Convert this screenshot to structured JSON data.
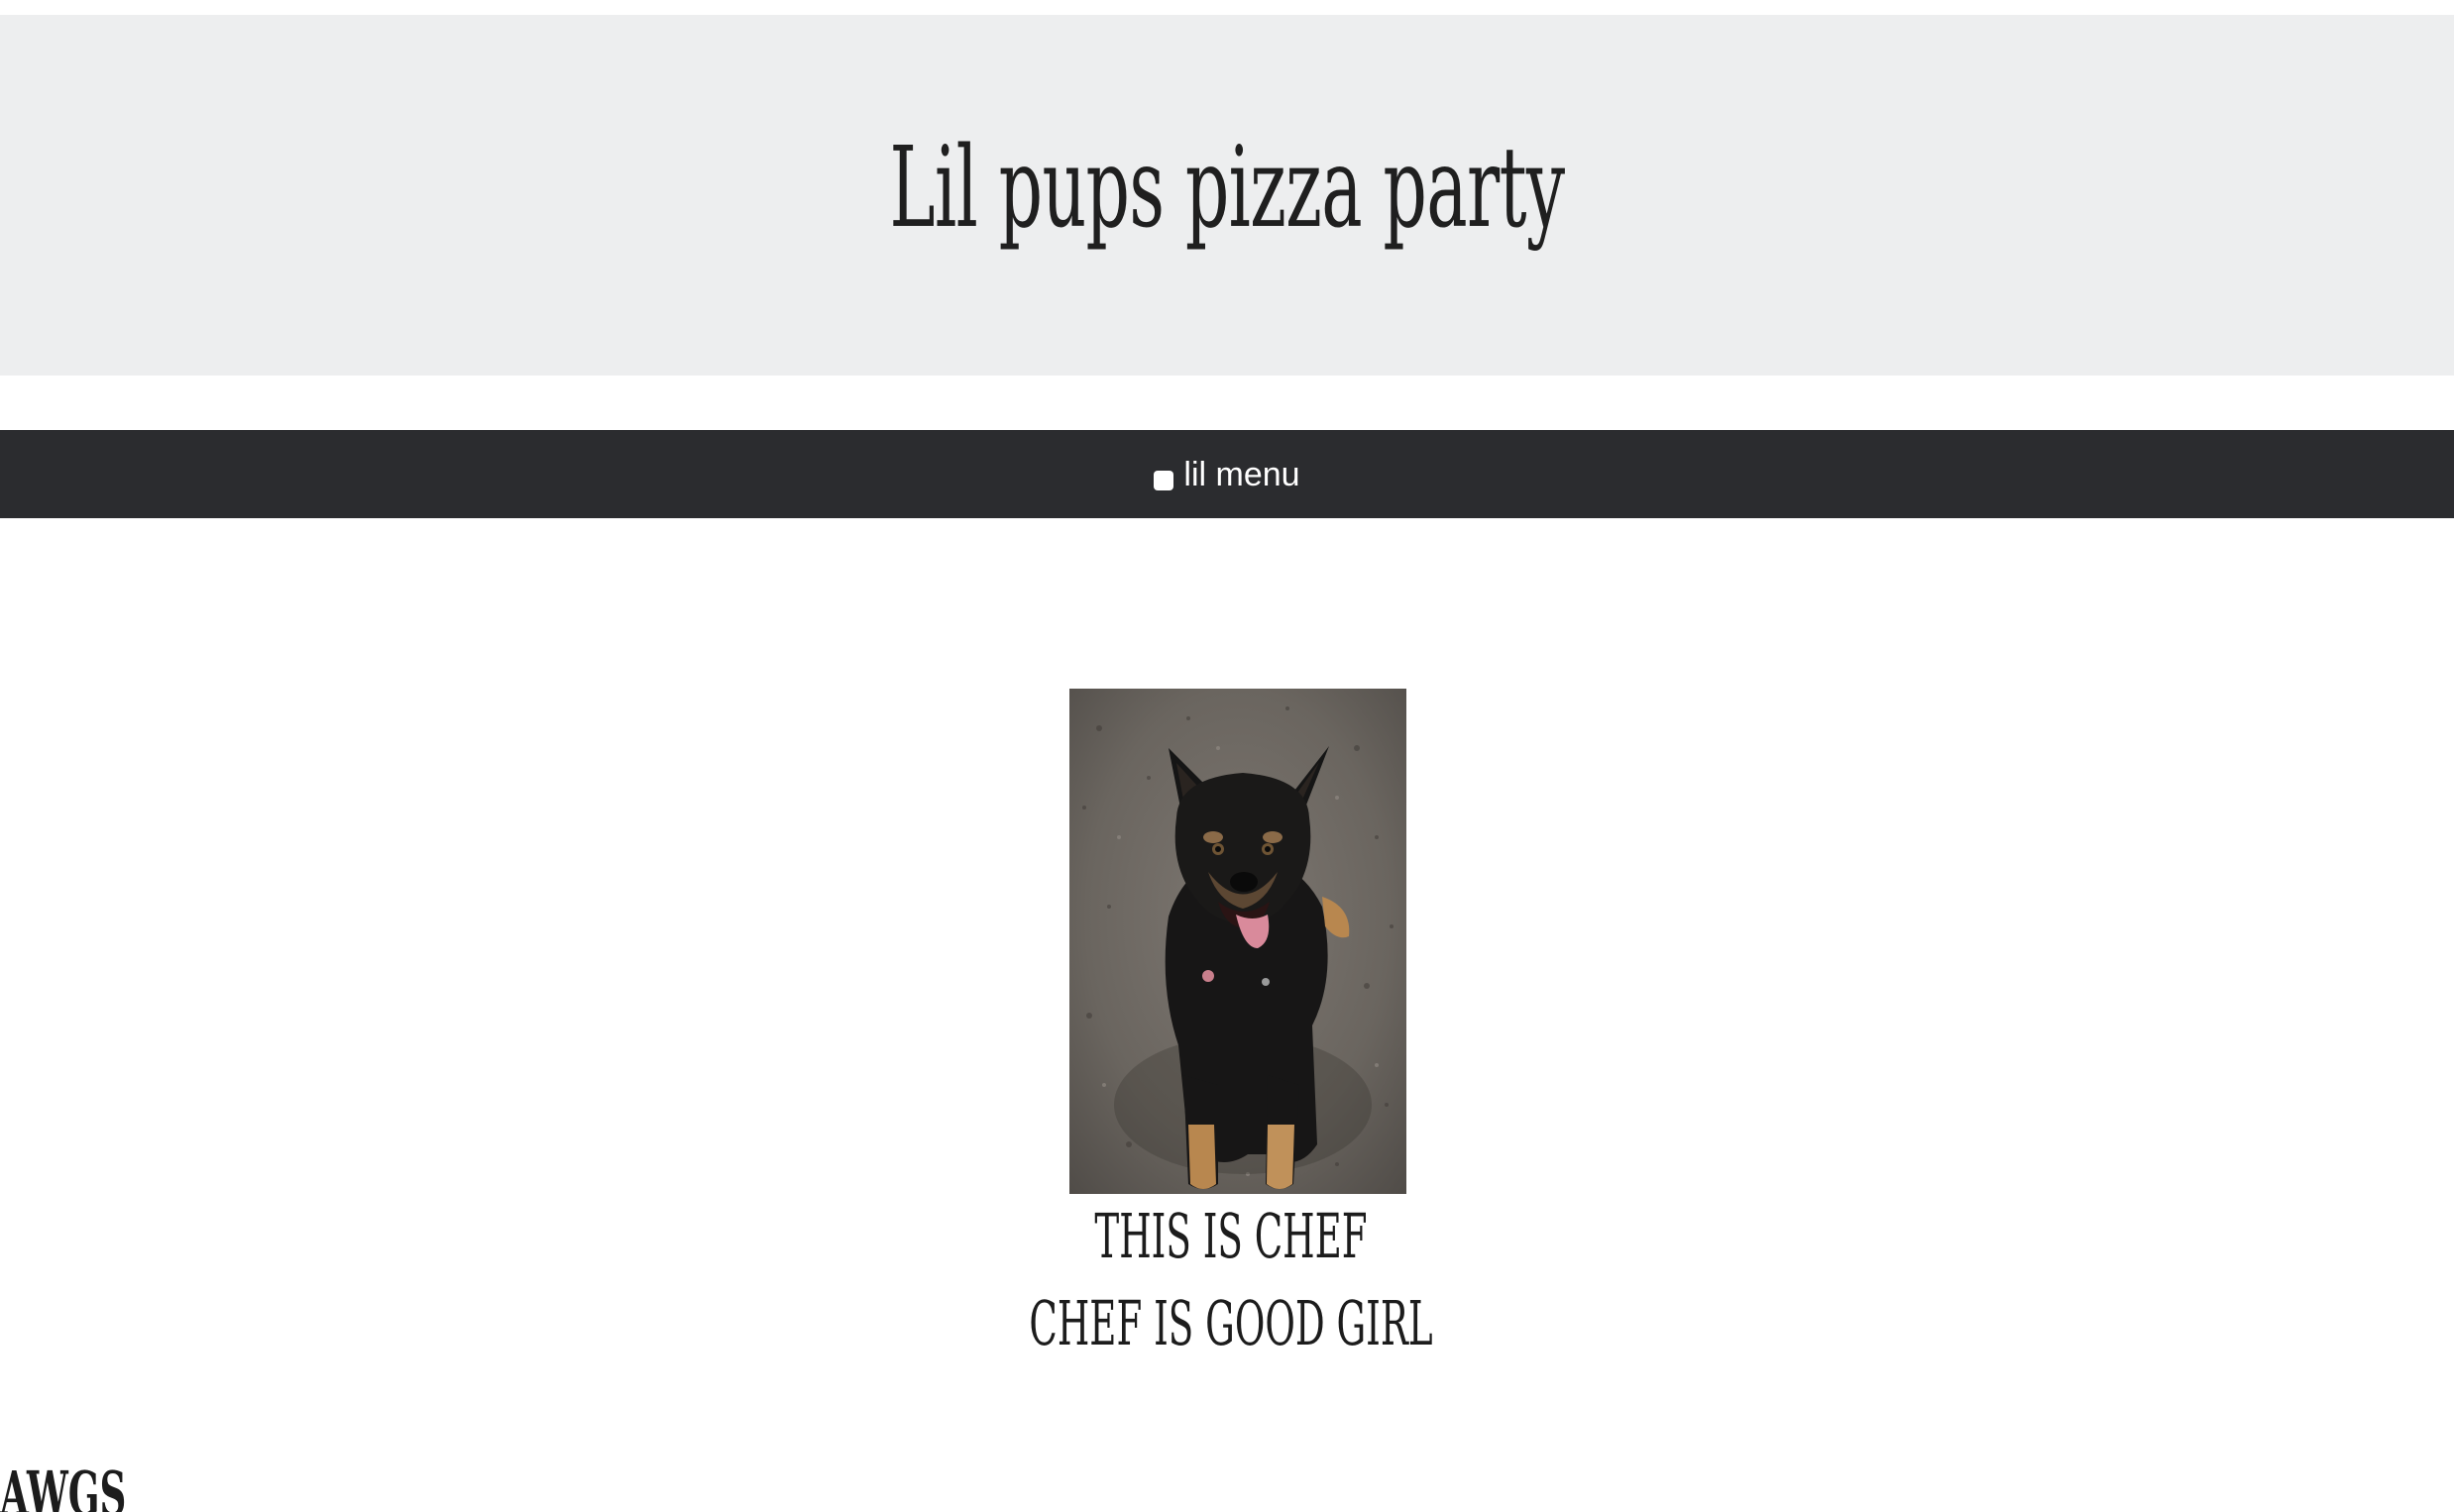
{
  "header": {
    "title": "Lil pups pizza party"
  },
  "nav": {
    "menu_label": "lil menu"
  },
  "main": {
    "photo_alt": "black and tan dog lying on dirt",
    "caption_line1": "THIS IS CHEF",
    "caption_line2": "CHEF IS GOOD GIRL"
  },
  "section": {
    "heading_partial": "AWGS"
  },
  "colors": {
    "hero_background": "#edeeef",
    "navbar_background": "#2b2c2f",
    "text": "#1c1c1c"
  }
}
